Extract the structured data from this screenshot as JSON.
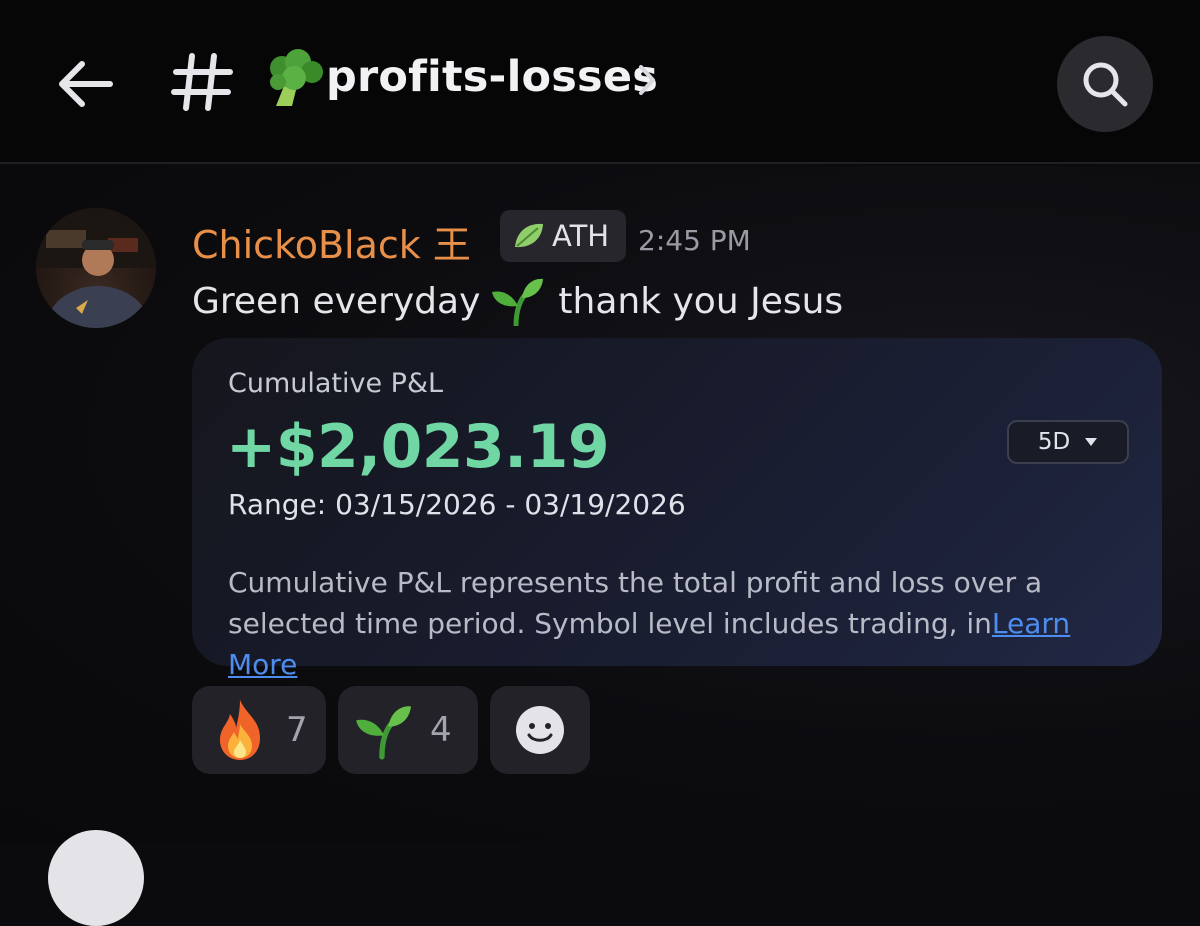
{
  "header": {
    "channel_name": "profits-losses",
    "icons": {
      "back": "arrow-left-icon",
      "hash": "hash-icon",
      "channel_emoji": "broccoli-emoji",
      "chevron": "chevron-right-icon",
      "search": "search-icon"
    }
  },
  "message": {
    "author": "ChickoBlack 王",
    "role_badge": "ATH",
    "role_badge_icon": "leaf-icon",
    "timestamp": "2:45 PM",
    "text_before": "Green everyday",
    "text_emoji": "seedling-emoji",
    "text_after": "thank you Jesus"
  },
  "pnl_card": {
    "title": "Cumulative P&L",
    "amount": "+$2,023.19",
    "period": "5D",
    "range": "Range: 03/15/2026 - 03/19/2026",
    "description": "Cumulative P&L represents the total profit and loss over a selected time period. Symbol level includes trading, in",
    "learn_more": "Learn More"
  },
  "reactions": [
    {
      "emoji": "fire-emoji",
      "count": "7"
    },
    {
      "emoji": "seedling-emoji",
      "count": "4"
    },
    {
      "emoji": "add-reaction-icon",
      "count": ""
    }
  ],
  "colors": {
    "username": "#e8904a",
    "amount": "#6fd6a4",
    "link": "#4d8df0",
    "background": "#0b0b0d"
  }
}
